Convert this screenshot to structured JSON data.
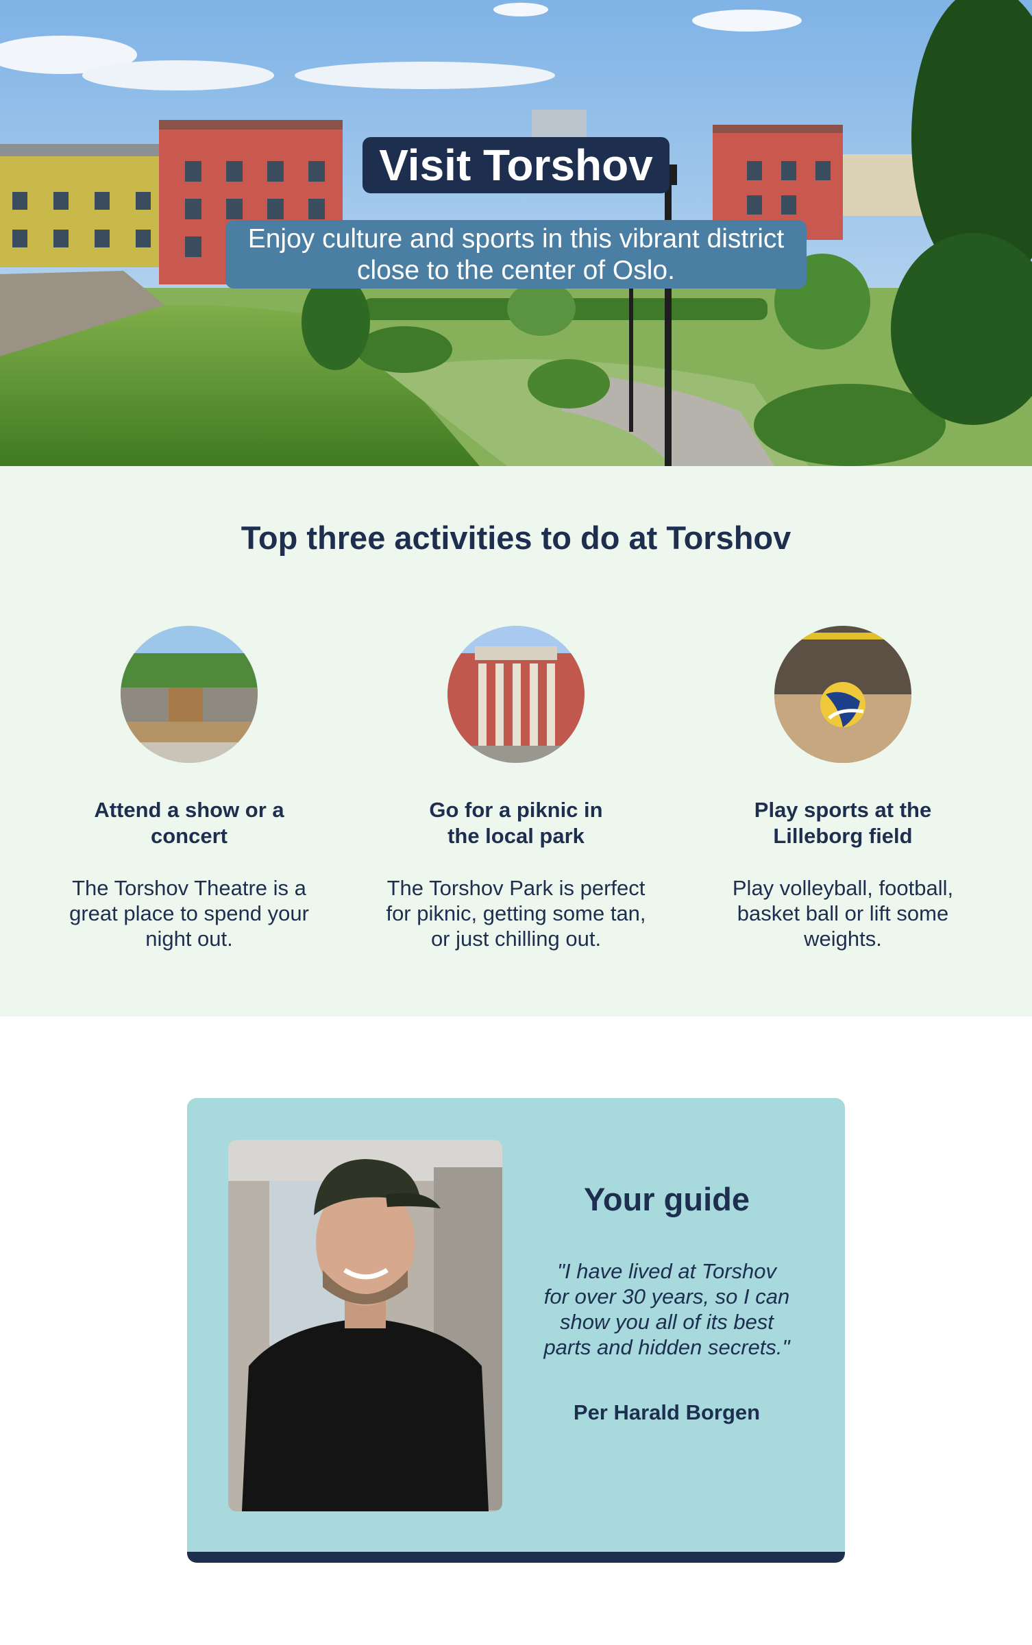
{
  "hero": {
    "title": "Visit Torshov",
    "subtitle": "Enjoy culture and sports in this vibrant district close to the center of Oslo."
  },
  "activities": {
    "heading": "Top three activities to do at Torshov",
    "items": [
      {
        "title": "Attend a show or a concert",
        "text": "The Torshov Theatre is a great place to spend your night out."
      },
      {
        "title": "Go for a piknic in the local park",
        "text": "The Torshov Park is perfect for piknic, getting some tan, or just chilling out."
      },
      {
        "title": "Play sports at the Lilleborg field",
        "text": "Play volleyball, football, basket ball or lift some weights."
      }
    ]
  },
  "guide": {
    "heading": "Your guide",
    "quote": "\"I have lived at Torshov for over 30 years, so I can show you all of its best parts and hidden secrets.\"",
    "name": "Per Harald Borgen"
  },
  "colors": {
    "navy": "#1d2e4f",
    "subtitle_bg": "#4a7fa3",
    "activities_bg": "#eef7ee",
    "guide_bg": "#a7d9dd"
  }
}
